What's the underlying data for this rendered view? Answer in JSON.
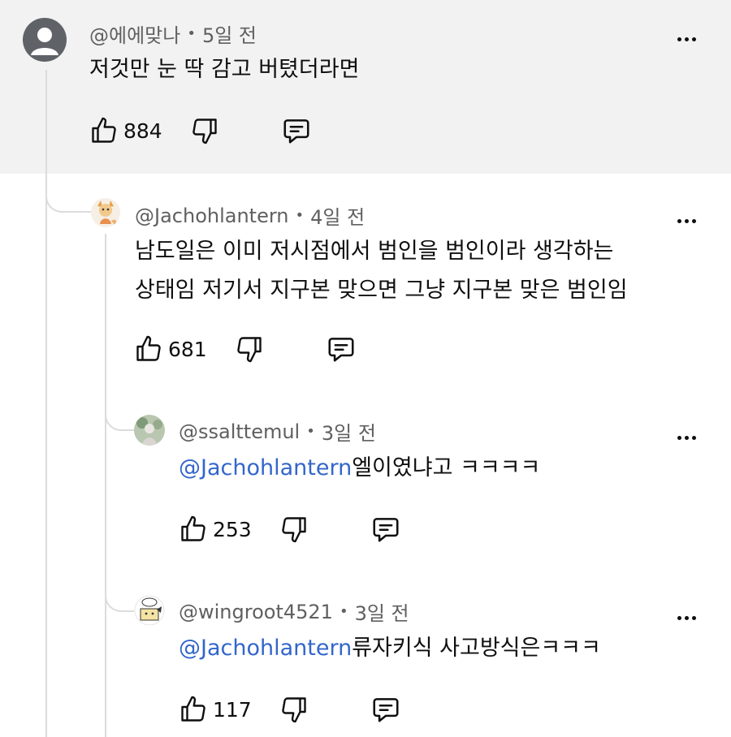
{
  "comments": [
    {
      "author": "@에에맞나",
      "time": "5일 전",
      "text": "저것만 눈 딱 감고 버텼더라면",
      "likes": "884"
    },
    {
      "author": "@Jachohlantern",
      "time": "4일 전",
      "text_line1": "남도일은 이미 저시점에서 범인을 범인이라 생각하는",
      "text_line2": "상태임 저기서 지구본 맞으면 그냥 지구본 맞은 범인임",
      "likes": "681"
    },
    {
      "author": "@ssalttemul",
      "time": "3일 전",
      "mention": "@Jachohlantern",
      "text": "엘이였냐고 ㅋㅋㅋㅋ",
      "likes": "253"
    },
    {
      "author": "@wingroot4521",
      "time": "3일 전",
      "mention": "@Jachohlantern",
      "text": "류자키식 사고방식은ㅋㅋㅋ",
      "likes": "117"
    }
  ],
  "separator": "•",
  "icons": {
    "like": "thumbs-up-icon",
    "dislike": "thumbs-down-icon",
    "reply": "reply-icon",
    "more": "more-vertical-icon"
  }
}
